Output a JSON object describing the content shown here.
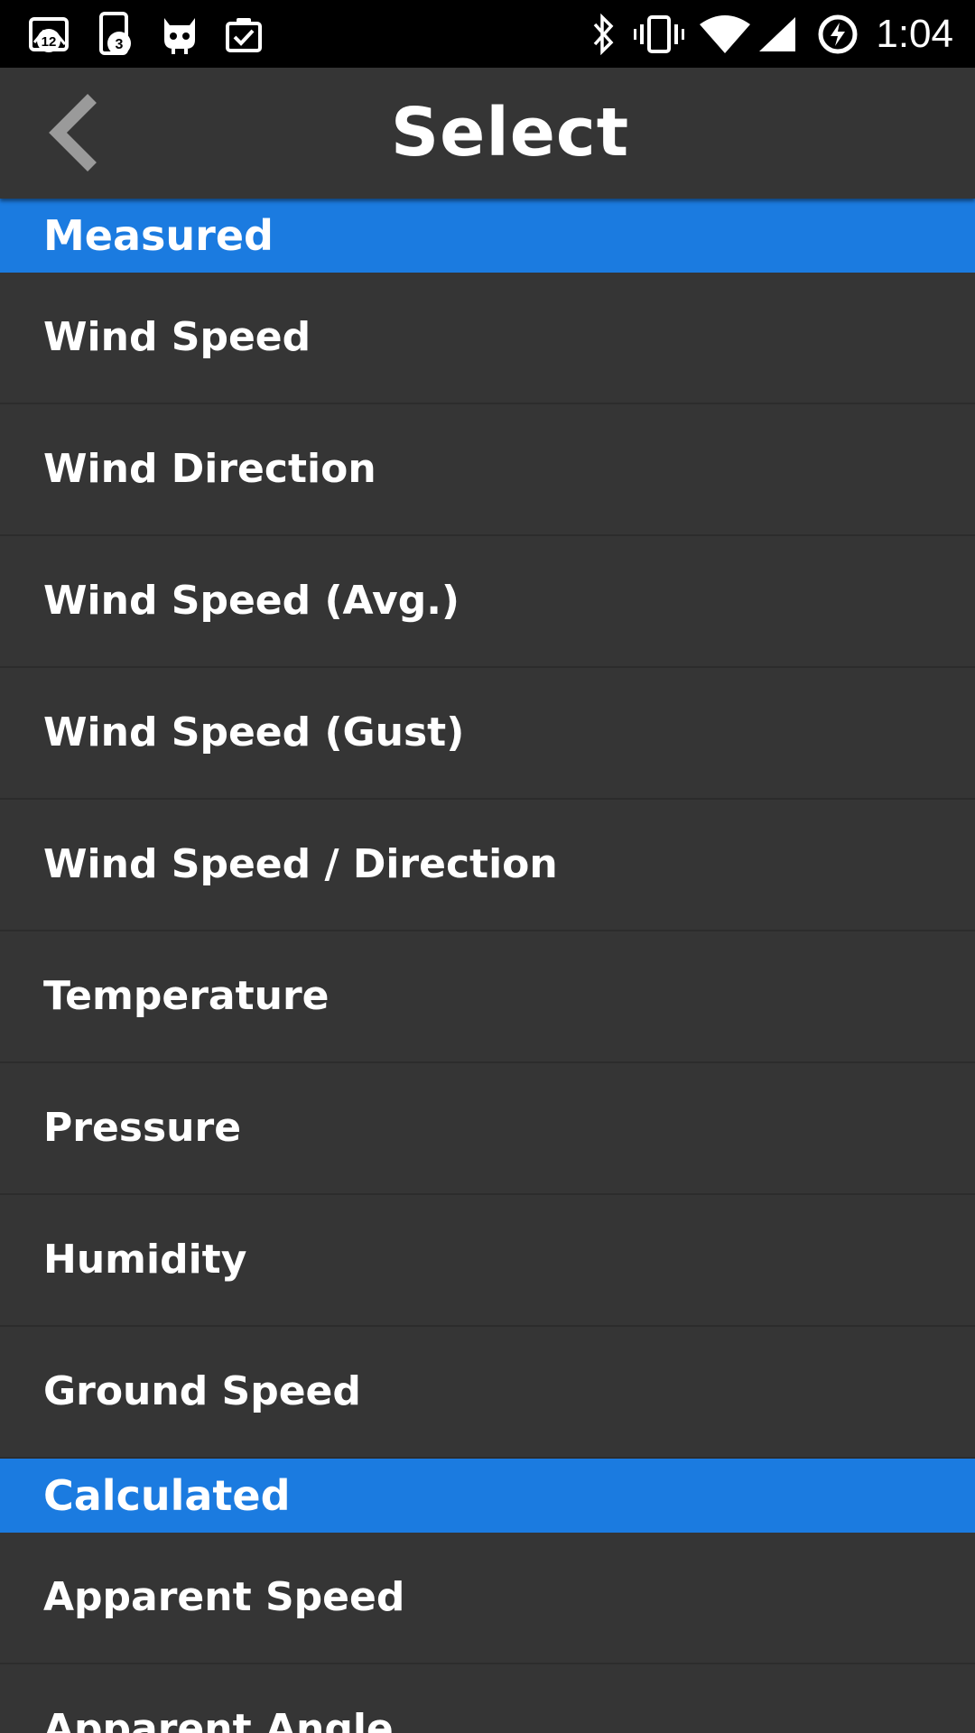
{
  "status_bar": {
    "time": "1:04",
    "notifications": {
      "gallery_count": "12",
      "phone_count": "3"
    },
    "icons": [
      "gallery-icon",
      "phone-icon",
      "cyanogen-icon",
      "clipboard-check-icon",
      "bluetooth-icon",
      "vibrate-icon",
      "wifi-icon",
      "cell-signal-icon",
      "battery-charging-icon"
    ]
  },
  "header": {
    "title": "Select",
    "back_icon": "chevron-left-icon"
  },
  "colors": {
    "accent": "#1b7be0",
    "background": "#353535",
    "status_bar": "#000000",
    "text": "#ffffff"
  },
  "sections": [
    {
      "title": "Measured",
      "items": [
        "Wind Speed",
        "Wind Direction",
        "Wind Speed (Avg.)",
        "Wind Speed (Gust)",
        "Wind Speed / Direction",
        "Temperature",
        "Pressure",
        "Humidity",
        "Ground Speed"
      ]
    },
    {
      "title": "Calculated",
      "items": [
        "Apparent Speed",
        "Apparent Angle"
      ]
    }
  ]
}
